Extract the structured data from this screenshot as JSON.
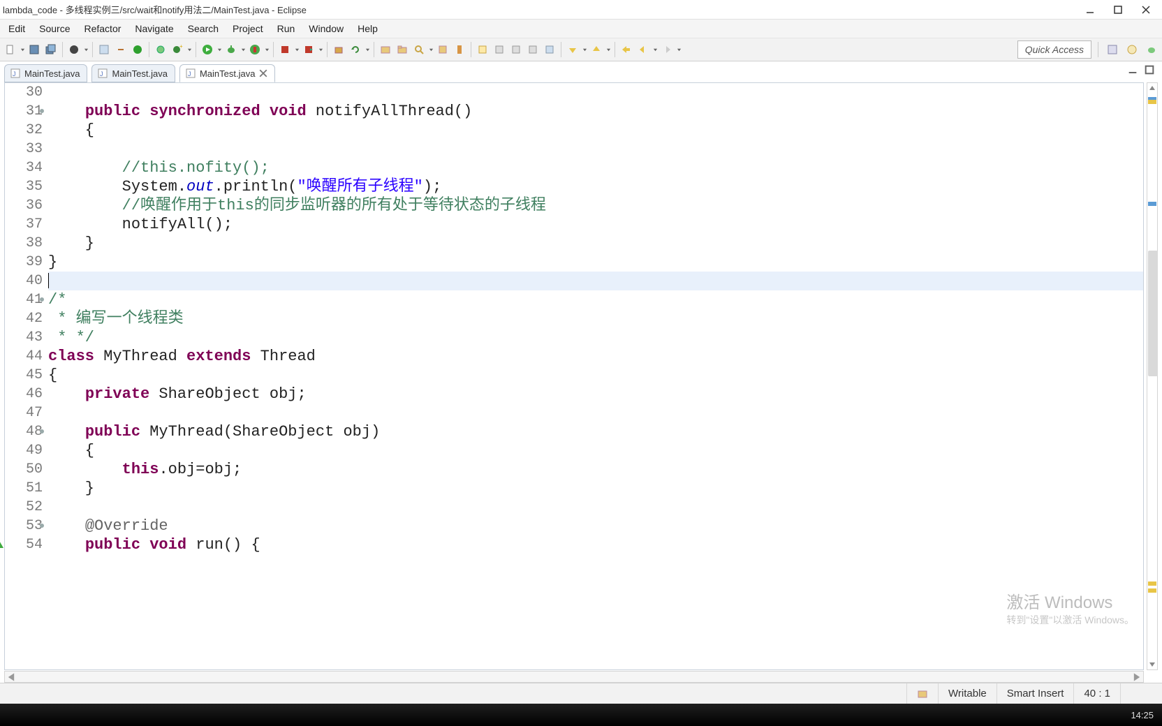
{
  "window": {
    "title": "lambda_code - 多线程实例三/src/wait和notify用法二/MainTest.java - Eclipse"
  },
  "menu": [
    "Edit",
    "Source",
    "Refactor",
    "Navigate",
    "Search",
    "Project",
    "Run",
    "Window",
    "Help"
  ],
  "quick_access_placeholder": "Quick Access",
  "tabs": [
    {
      "label": "MainTest.java",
      "active": false
    },
    {
      "label": "MainTest.java",
      "active": false
    },
    {
      "label": "MainTest.java",
      "active": true,
      "closeable": true
    }
  ],
  "gutter": {
    "start": 30,
    "end": 54,
    "fold_lines": [
      31,
      41,
      48,
      53
    ],
    "warn_lines": [
      54
    ]
  },
  "code_lines": [
    {
      "n": 30,
      "html": ""
    },
    {
      "n": 31,
      "html": "    <span class='kw'>public</span> <span class='kw'>synchronized</span> <span class='kw'>void</span> notifyAllThread()"
    },
    {
      "n": 32,
      "html": "    {"
    },
    {
      "n": 33,
      "html": ""
    },
    {
      "n": 34,
      "html": "        <span class='com'>//this.nofity();</span>"
    },
    {
      "n": 35,
      "html": "        System.<span class='field'>out</span>.println(<span class='str'>\"唤醒所有子线程\"</span>);"
    },
    {
      "n": 36,
      "html": "        <span class='com'>//唤醒作用于this的同步监听器的所有处于等待状态的子线程</span>"
    },
    {
      "n": 37,
      "html": "        notifyAll();"
    },
    {
      "n": 38,
      "html": "    }"
    },
    {
      "n": 39,
      "html": "}"
    },
    {
      "n": 40,
      "html": "<span class='cursor'></span>",
      "current": true
    },
    {
      "n": 41,
      "html": "<span class='com'>/*</span>"
    },
    {
      "n": 42,
      "html": "<span class='com'> * 编写一个线程类</span>"
    },
    {
      "n": 43,
      "html": "<span class='com'> * */</span>"
    },
    {
      "n": 44,
      "html": "<span class='kw'>class</span> MyThread <span class='kw'>extends</span> Thread"
    },
    {
      "n": 45,
      "html": "{"
    },
    {
      "n": 46,
      "html": "    <span class='kw'>private</span> ShareObject obj;"
    },
    {
      "n": 47,
      "html": ""
    },
    {
      "n": 48,
      "html": "    <span class='kw'>public</span> MyThread(ShareObject obj)"
    },
    {
      "n": 49,
      "html": "    {"
    },
    {
      "n": 50,
      "html": "        <span class='kw'>this</span>.obj=obj;"
    },
    {
      "n": 51,
      "html": "    }"
    },
    {
      "n": 52,
      "html": ""
    },
    {
      "n": 53,
      "html": "    <span class='ann'>@Override</span>"
    },
    {
      "n": 54,
      "html": "    <span class='kw'>public</span> <span class='kw'>void</span> run() {"
    }
  ],
  "status": {
    "writable": "Writable",
    "insert_mode": "Smart Insert",
    "position": "40 : 1"
  },
  "watermark": {
    "line1": "激活 Windows",
    "line2": "转到\"设置\"以激活 Windows。"
  },
  "taskbar_time": "14:25"
}
